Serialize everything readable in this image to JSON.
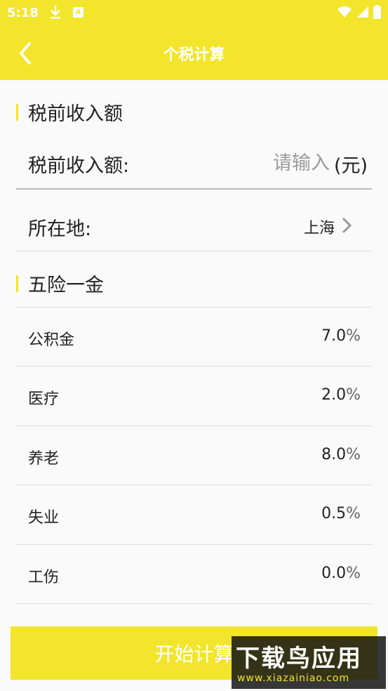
{
  "status_bar": {
    "time": "5:18",
    "download_icon": "download-icon",
    "app_icon_letter": "A"
  },
  "app_bar": {
    "title": "个税计算",
    "back_icon": "chevron-left-icon"
  },
  "income_section": {
    "header": "税前收入额",
    "income_label": "税前收入额:",
    "income_placeholder": "请输入",
    "income_value": "",
    "unit": "(元)"
  },
  "location": {
    "label": "所在地:",
    "value": "上海",
    "icon": "chevron-right-icon"
  },
  "insurance_section": {
    "header": "五险一金",
    "items": [
      {
        "label": "公积金",
        "value": "7.0",
        "unit": "%"
      },
      {
        "label": "医疗",
        "value": "2.0",
        "unit": "%"
      },
      {
        "label": "养老",
        "value": "8.0",
        "unit": "%"
      },
      {
        "label": "失业",
        "value": "0.5",
        "unit": "%"
      },
      {
        "label": "工伤",
        "value": "0.0",
        "unit": "%"
      }
    ]
  },
  "action": {
    "start_label": "开始计算"
  },
  "watermark": {
    "line1": "下载鸟应用",
    "line2": "www.xiazainiao.com"
  },
  "colors": {
    "accent": "#f2e52b",
    "background": "#fafafa",
    "text": "#222222",
    "placeholder": "#9a9a9a"
  }
}
